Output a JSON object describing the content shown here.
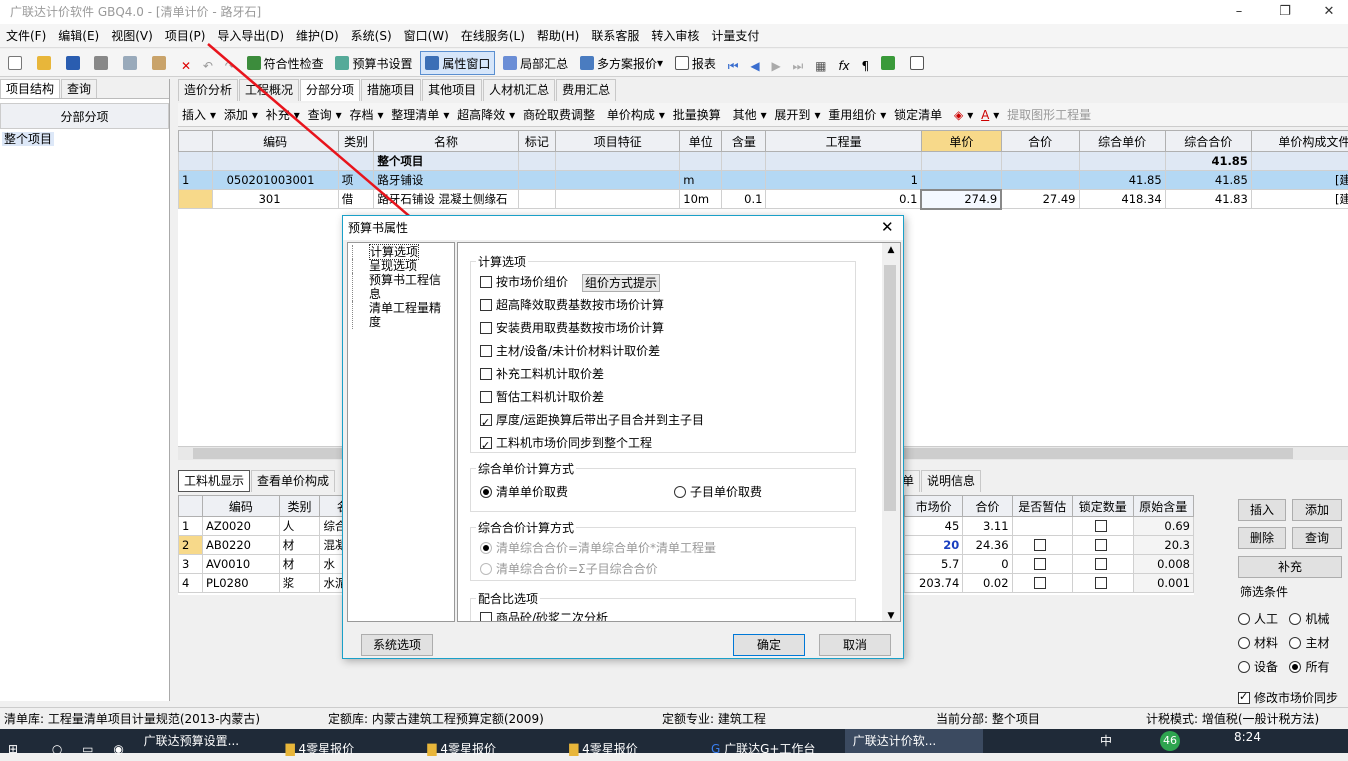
{
  "window": {
    "title": "广联达计价软件 GBQ4.0 - [清单计价 - 路牙石]",
    "min": "–",
    "restore": "❐",
    "close": "✕"
  },
  "menu": [
    "文件(F)",
    "编辑(E)",
    "视图(V)",
    "项目(P)",
    "导入导出(D)",
    "维护(D)",
    "系统(S)",
    "窗口(W)",
    "在线服务(L)",
    "帮助(H)",
    "联系客服",
    "转入审核",
    "计量支付"
  ],
  "toolbar": {
    "check": "符合性检查",
    "budget": "预算书设置",
    "prop": "属性窗口",
    "partial": "局部汇总",
    "multi": "多方案报价",
    "report": "报表"
  },
  "left_tabs": [
    "项目结构",
    "查询"
  ],
  "left_header": "分部分项",
  "left_tree": [
    "整个项目"
  ],
  "nav_tabs": [
    "造价分析",
    "工程概况",
    "分部分项",
    "措施项目",
    "其他项目",
    "人材机汇总",
    "费用汇总"
  ],
  "tb2": [
    "插入",
    "添加",
    "补充",
    "查询",
    "存档",
    "整理清单",
    "超高降效",
    "商砼取费调整",
    "单价构成",
    "批量换算",
    "其他",
    "展开到",
    "重用组价",
    "锁定清单",
    "提取图形工程量"
  ],
  "main_table": {
    "headers": [
      "",
      "编码",
      "类别",
      "名称",
      "标记",
      "项目特征",
      "单位",
      "含量",
      "工程量",
      "单价",
      "合价",
      "综合单价",
      "综合合价",
      "单价构成文件"
    ],
    "rows": [
      [
        "",
        "",
        "",
        "整个项目",
        "",
        "",
        "",
        "",
        "",
        "",
        "",
        "",
        "41.85",
        ""
      ],
      [
        "1",
        "050201003001",
        "项",
        "路牙铺设",
        "",
        "",
        "m",
        "",
        "1",
        "",
        "",
        "41.85",
        "41.85",
        "[建筑工"
      ],
      [
        "",
        "301",
        "借",
        "路牙石铺设 混凝土侧缘石",
        "",
        "",
        "10m",
        "0.1",
        "0.1",
        "274.9",
        "27.49",
        "418.34",
        "41.83",
        "[建筑工"
      ]
    ]
  },
  "bottom_tabs": [
    "工料机显示",
    "查看单价构成"
  ],
  "bottom_tabs_right": [
    "单",
    "说明信息"
  ],
  "bottom_table": {
    "headers": [
      "",
      "编码",
      "类别",
      "名称"
    ],
    "rows": [
      [
        "1",
        "AZ0020",
        "人",
        "综合工"
      ],
      [
        "2",
        "AB0220",
        "材",
        "混凝土"
      ],
      [
        "3",
        "AV0010",
        "材",
        "水"
      ],
      [
        "4",
        "PL0280",
        "浆",
        "水泥砂"
      ]
    ]
  },
  "bottom_table_right": {
    "headers": [
      "市场价",
      "合价",
      "是否暂估",
      "锁定数量",
      "原始含量"
    ],
    "rows": [
      [
        "45",
        "3.11",
        "",
        "",
        "0.69"
      ],
      [
        "20",
        "24.36",
        "",
        "",
        "20.3"
      ],
      [
        "5.7",
        "0",
        "",
        "",
        "0.008"
      ],
      [
        "203.74",
        "0.02",
        "",
        "",
        "0.001"
      ]
    ]
  },
  "right_buttons": [
    "插入",
    "添加",
    "删除",
    "查询",
    "补充"
  ],
  "filter": {
    "label": "筛选条件",
    "options": [
      "人工",
      "机械",
      "材料",
      "主材",
      "设备",
      "所有"
    ],
    "selected": "所有",
    "sync": "修改市场价同步"
  },
  "dialog": {
    "title": "预算书属性",
    "tree": [
      "计算选项",
      "呈现选项",
      "预算书工程信息",
      "清单工程量精度"
    ],
    "group1": "计算选项",
    "opts": [
      {
        "label": "按市场价组价",
        "checked": false
      },
      {
        "label": "超高降效取费基数按市场价计算",
        "checked": false
      },
      {
        "label": "安装费用取费基数按市场价计算",
        "checked": false
      },
      {
        "label": "主材/设备/未计价材料计取价差",
        "checked": false
      },
      {
        "label": "补充工料机计取价差",
        "checked": false
      },
      {
        "label": "暂估工料机计取价差",
        "checked": false
      },
      {
        "label": "厚度/运距换算后带出子目合并到主子目",
        "checked": true
      },
      {
        "label": "工料机市场价同步到整个工程",
        "checked": true
      }
    ],
    "tip_btn": "组价方式提示",
    "group2": "综合单价计算方式",
    "r2": [
      "清单单价取费",
      "子目单价取费"
    ],
    "group3": "综合合价计算方式",
    "r3": [
      "清单综合合价=清单综合单价*清单工程量",
      "清单综合合价=Σ子目综合合价"
    ],
    "group4": "配合比选项",
    "opt_last": "商品砼/砂浆二次分析",
    "sys_btn": "系统选项",
    "ok": "确定",
    "cancel": "取消"
  },
  "status": [
    "清单库: 工程量清单项目计量规范(2013-内蒙古)",
    "定额库: 内蒙古建筑工程预算定额(2009)",
    "定额专业: 建筑工程",
    "当前分部: 整个项目",
    "计税模式: 增值税(一般计税方法)"
  ],
  "taskbar": {
    "items": [
      "广联达预算设置...",
      "4零星报价",
      "4零星报价",
      "4零星报价",
      "广联达G+工作台",
      "广联达计价软..."
    ],
    "time": "8:24",
    "lang": "中",
    "badge": "46"
  },
  "colors": {
    "highlight_red": "#e8141c",
    "accent": "#1aa0c8",
    "row_sel": "#b4d8f4"
  }
}
